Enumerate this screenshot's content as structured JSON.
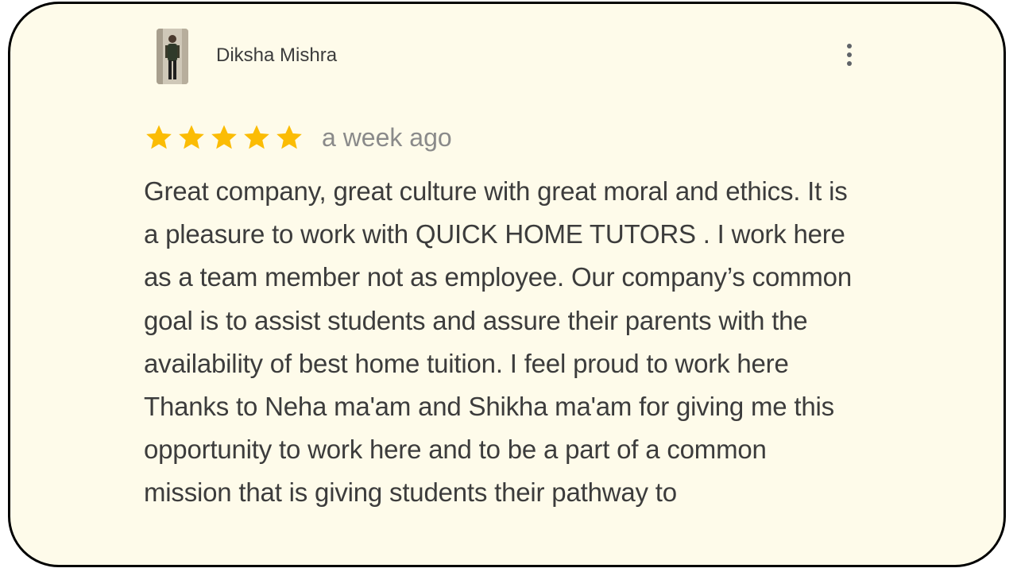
{
  "review": {
    "reviewer_name": "Diksha Mishra",
    "avatar": "reviewer-avatar-photo",
    "menu_icon": "more-vert-icon",
    "rating": 5,
    "rating_max": 5,
    "star_color": "#fbbc04",
    "time": "a week ago",
    "text": "Great company, great culture with great moral and ethics. It is a pleasure to work with QUICK HOME TUTORS . I work here as a team member not as employee. Our company’s common goal is to assist students and assure their parents with the availability of best home tuition. I feel proud to work here Thanks to Neha ma'am and Shikha ma'am for giving me this opportunity to work here and to be a part of a common mission that is giving students their pathway to"
  },
  "colors": {
    "card_background": "#fefbea",
    "card_border": "#000000",
    "text": "#3c3c3c",
    "muted_text": "#8a8a8a"
  }
}
